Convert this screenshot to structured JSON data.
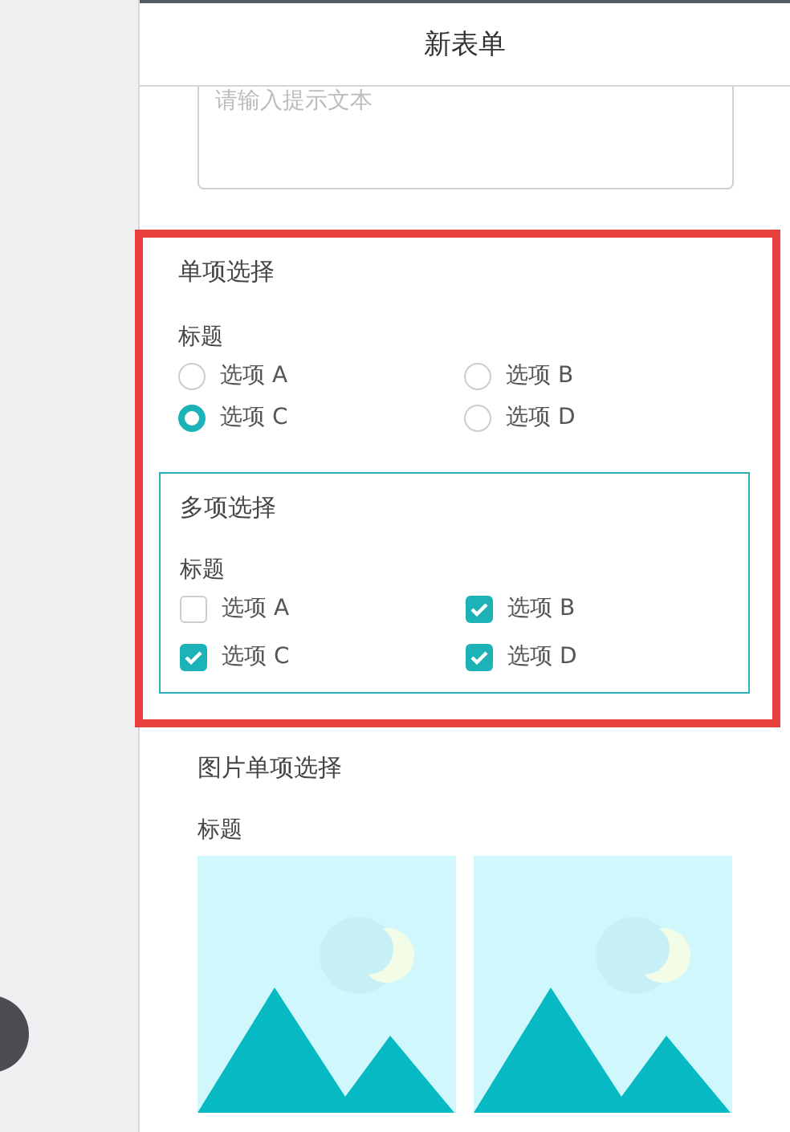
{
  "header": {
    "title": "新表单"
  },
  "text_area": {
    "placeholder": "请输入提示文本"
  },
  "single_choice": {
    "title": "单项选择",
    "label": "标题",
    "highlighted": true,
    "options": [
      {
        "label": "选项 A",
        "selected": false
      },
      {
        "label": "选项 B",
        "selected": false
      },
      {
        "label": "选项 C",
        "selected": true
      },
      {
        "label": "选项 D",
        "selected": false
      }
    ]
  },
  "multi_choice": {
    "title": "多项选择",
    "label": "标题",
    "options": [
      {
        "label": "选项 A",
        "checked": false
      },
      {
        "label": "选项 B",
        "checked": true
      },
      {
        "label": "选项 C",
        "checked": true
      },
      {
        "label": "选项 D",
        "checked": true
      }
    ]
  },
  "image_choice": {
    "title": "图片单项选择",
    "label": "标题"
  }
}
